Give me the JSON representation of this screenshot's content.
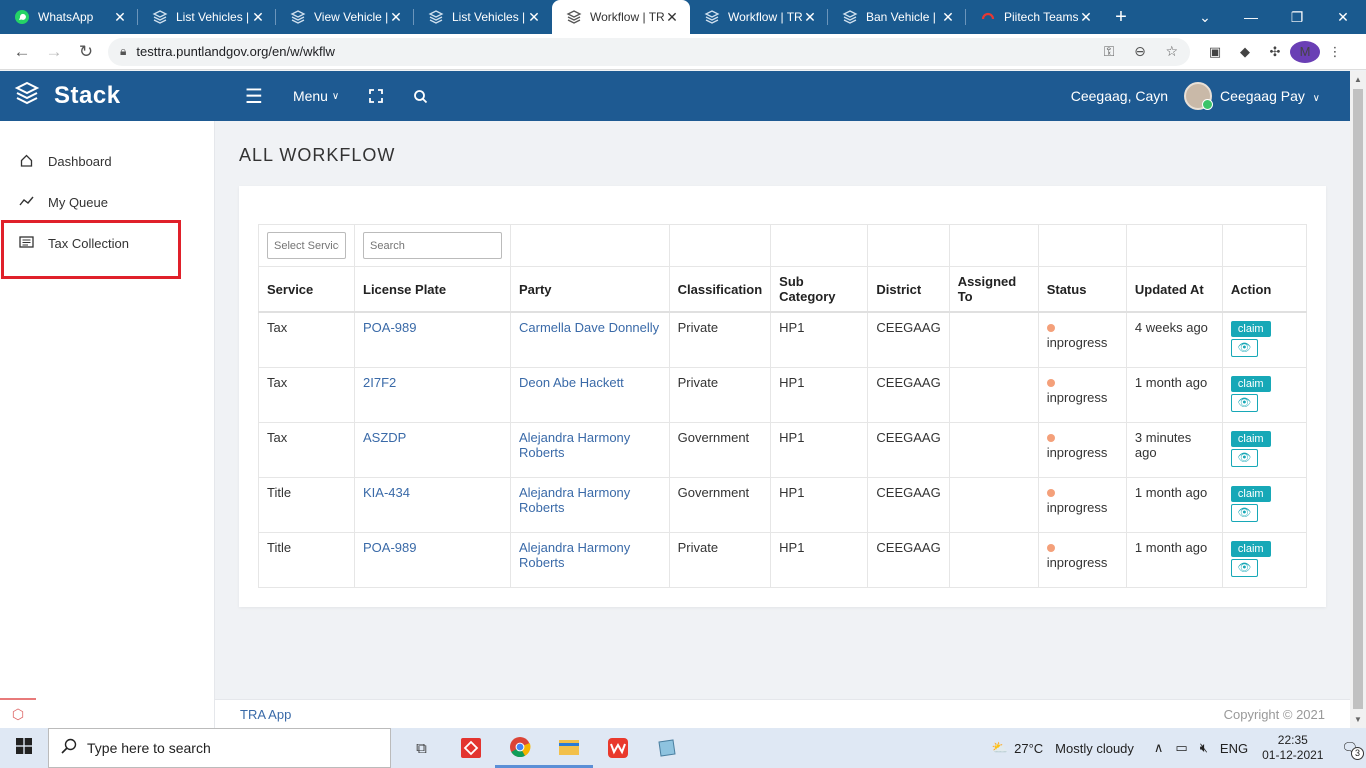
{
  "browser": {
    "tabs": [
      {
        "title": "WhatsApp",
        "icon": "whatsapp-icon",
        "active": false
      },
      {
        "title": "List Vehicles |",
        "icon": "stack-icon",
        "active": false
      },
      {
        "title": "View Vehicle |",
        "icon": "stack-icon",
        "active": false
      },
      {
        "title": "List Vehicles |",
        "icon": "stack-icon",
        "active": false
      },
      {
        "title": "Workflow | TR",
        "icon": "stack-icon",
        "active": true
      },
      {
        "title": "Workflow | TR",
        "icon": "stack-icon",
        "active": false
      },
      {
        "title": "Ban Vehicle |",
        "icon": "stack-icon",
        "active": false
      },
      {
        "title": "Piitech Teams",
        "icon": "headset-icon",
        "active": false
      }
    ],
    "url": "testtra.puntlandgov.org/en/w/wkflw",
    "profile_initial": "M"
  },
  "app": {
    "brand": "Stack",
    "menu_label": "Menu",
    "location": "Ceegaag, Cayn",
    "user_name": "Ceegaag Pay"
  },
  "sidebar": {
    "items": [
      {
        "label": "Dashboard",
        "icon": "home-icon"
      },
      {
        "label": "My Queue",
        "icon": "trend-icon"
      },
      {
        "label": "Tax Collection",
        "icon": "list-icon"
      }
    ]
  },
  "page": {
    "title": "ALL WORKFLOW",
    "filters": {
      "service_placeholder": "Select Service",
      "search_placeholder": "Search"
    },
    "columns": [
      "Service",
      "License Plate",
      "Party",
      "Classification",
      "Sub Category",
      "District",
      "Assigned To",
      "Status",
      "Updated At",
      "Action"
    ],
    "rows": [
      {
        "service": "Tax",
        "plate": "POA-989",
        "party": "Carmella Dave Donnelly",
        "classification": "Private",
        "sub_category": "HP1",
        "district": "CEEGAAG",
        "assigned": "",
        "status": "inprogress",
        "updated": "4 weeks ago",
        "claim": "claim"
      },
      {
        "service": "Tax",
        "plate": "2I7F2",
        "party": "Deon Abe Hackett",
        "classification": "Private",
        "sub_category": "HP1",
        "district": "CEEGAAG",
        "assigned": "",
        "status": "inprogress",
        "updated": "1 month ago",
        "claim": "claim"
      },
      {
        "service": "Tax",
        "plate": "ASZDP",
        "party": "Alejandra Harmony Roberts",
        "classification": "Government",
        "sub_category": "HP1",
        "district": "CEEGAAG",
        "assigned": "",
        "status": "inprogress",
        "updated": "3 minutes ago",
        "claim": "claim"
      },
      {
        "service": "Title",
        "plate": "KIA-434",
        "party": "Alejandra Harmony Roberts",
        "classification": "Government",
        "sub_category": "HP1",
        "district": "CEEGAAG",
        "assigned": "",
        "status": "inprogress",
        "updated": "1 month ago",
        "claim": "claim"
      },
      {
        "service": "Title",
        "plate": "POA-989",
        "party": "Alejandra Harmony Roberts",
        "classification": "Private",
        "sub_category": "HP1",
        "district": "CEEGAAG",
        "assigned": "",
        "status": "inprogress",
        "updated": "1 month ago",
        "claim": "claim"
      }
    ]
  },
  "footer": {
    "left": "TRA App",
    "right": "Copyright © 2021"
  },
  "taskbar": {
    "search_placeholder": "Type here to search",
    "temperature": "27°C",
    "weather": "Mostly cloudy",
    "language": "ENG",
    "time": "22:35",
    "date": "01-12-2021",
    "notifications": "3"
  },
  "colors": {
    "header": "#1e5a92",
    "tabbar": "#1a5a8f",
    "accent": "#17a8b7",
    "link": "#3a6aa8",
    "status_dot": "#f4a07a",
    "highlight": "#e0202a"
  }
}
